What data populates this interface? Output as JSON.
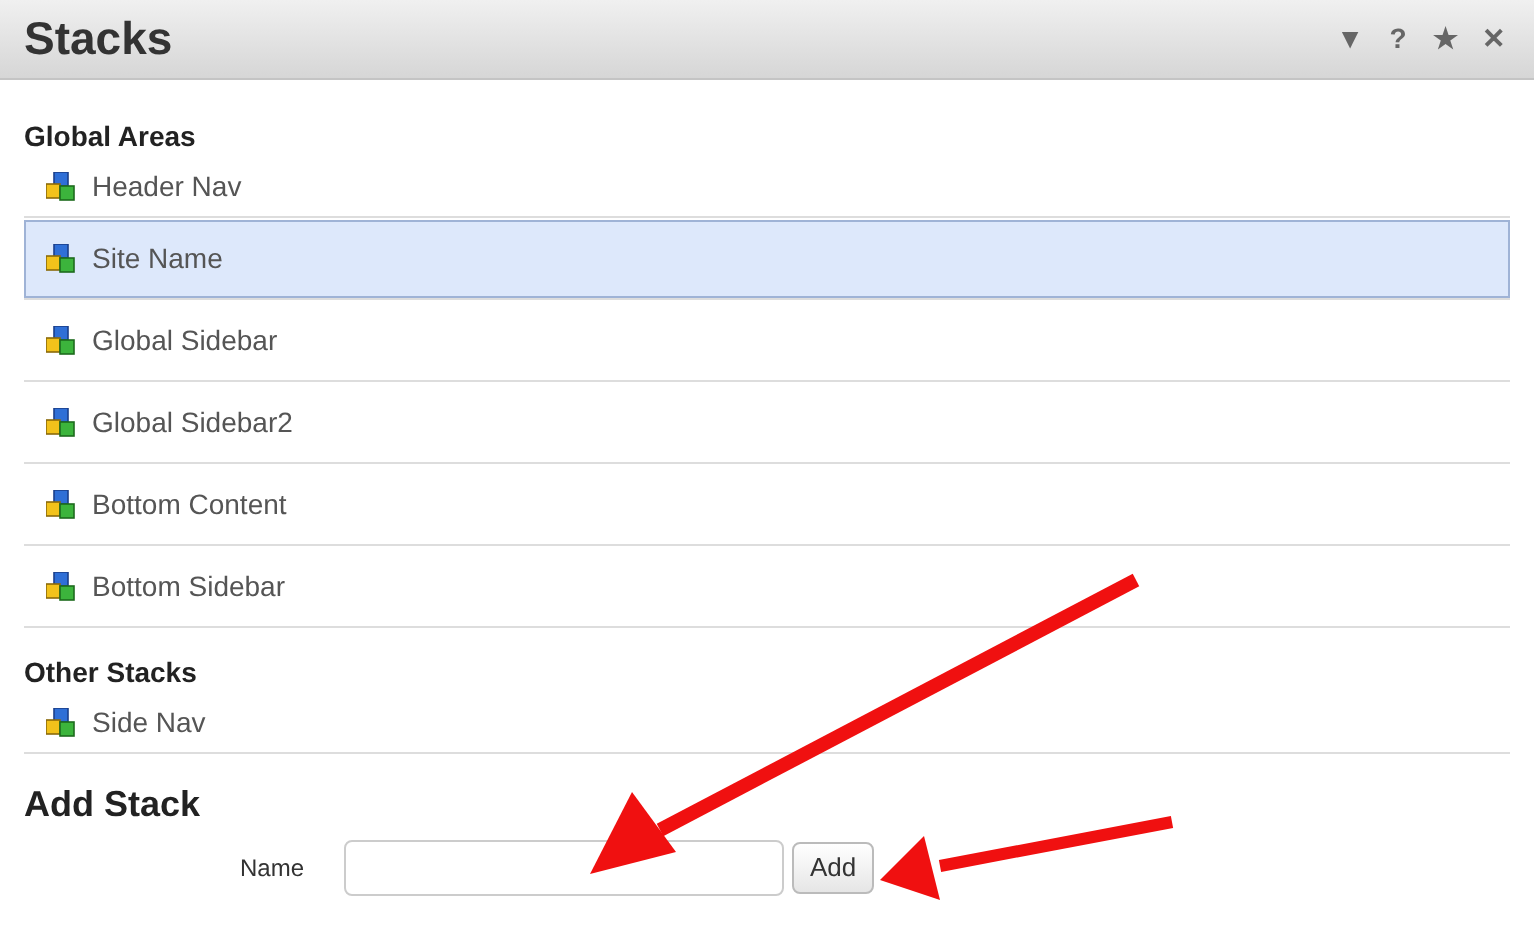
{
  "window": {
    "title": "Stacks",
    "controls": [
      "▼",
      "?",
      "★",
      "✕"
    ]
  },
  "sections": [
    {
      "heading": "Global Areas",
      "items": [
        {
          "label": "Header Nav",
          "selected": false
        },
        {
          "label": "Site Name",
          "selected": true
        },
        {
          "label": "Global Sidebar",
          "selected": false
        },
        {
          "label": "Global Sidebar2",
          "selected": false
        },
        {
          "label": "Bottom Content",
          "selected": false
        },
        {
          "label": "Bottom Sidebar",
          "selected": false
        }
      ]
    },
    {
      "heading": "Other Stacks",
      "items": [
        {
          "label": "Side Nav",
          "selected": false
        }
      ]
    }
  ],
  "add_stack": {
    "heading": "Add Stack",
    "label": "Name",
    "button": "Add"
  }
}
